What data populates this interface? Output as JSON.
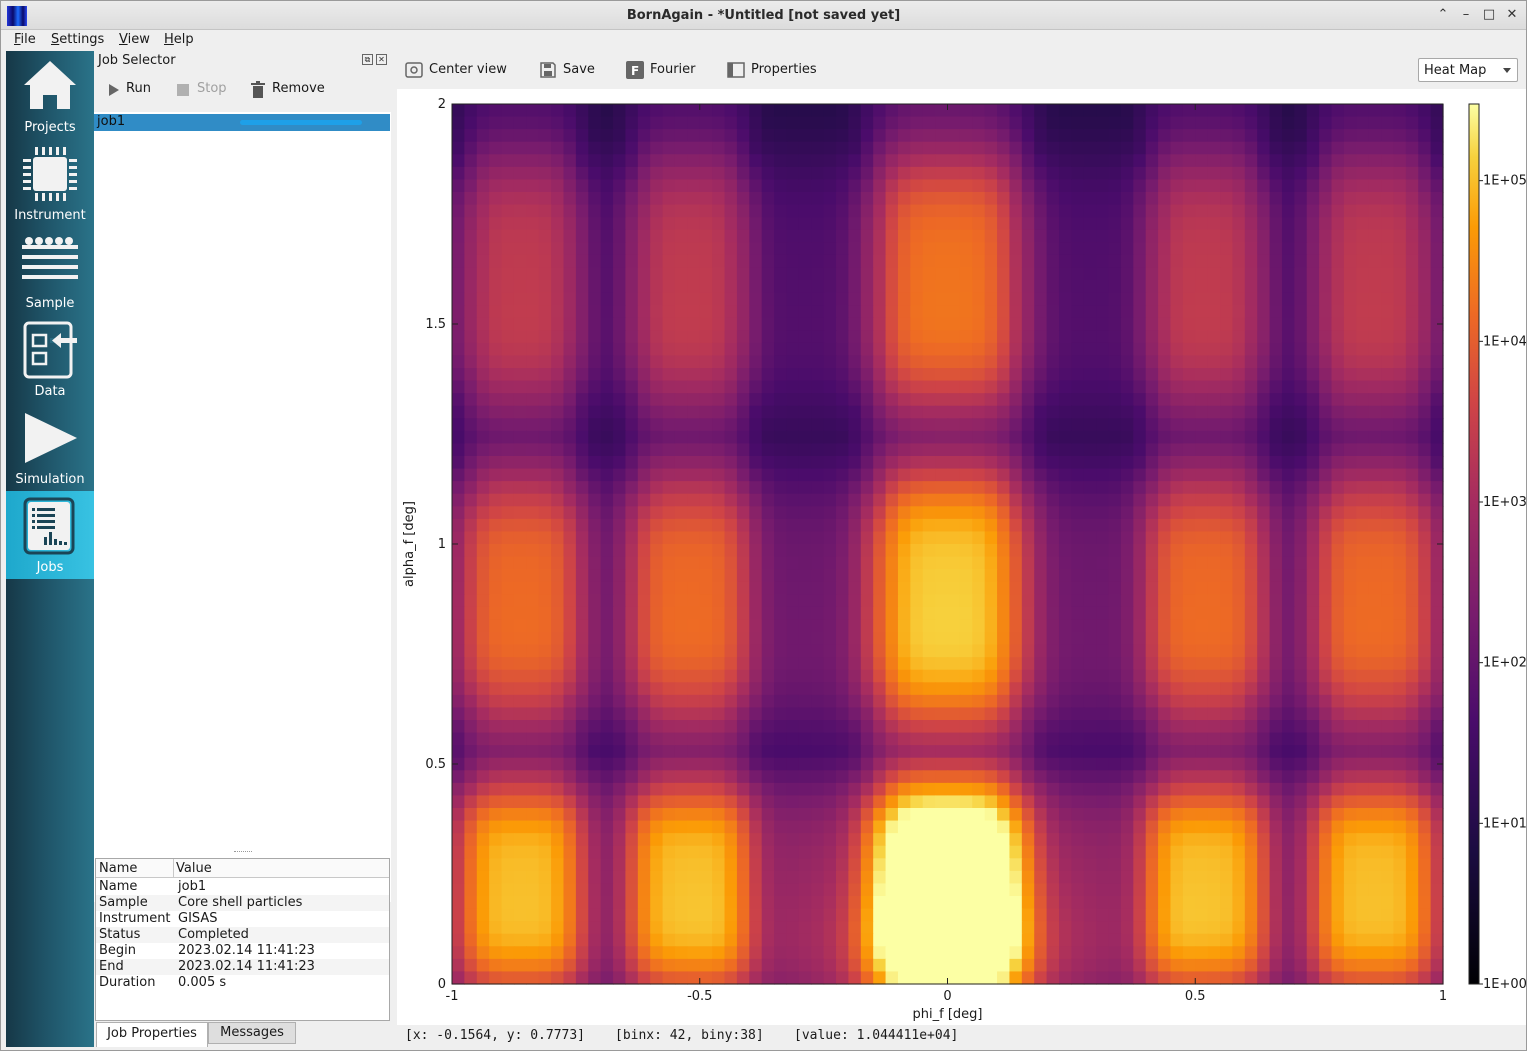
{
  "window": {
    "title": "BornAgain - *Untitled [not saved yet]"
  },
  "menu": [
    "File",
    "Settings",
    "View",
    "Help"
  ],
  "sidebar": {
    "items": [
      {
        "label": "Projects",
        "icon": "house-icon"
      },
      {
        "label": "Instrument",
        "icon": "chip-icon"
      },
      {
        "label": "Sample",
        "icon": "layers-icon"
      },
      {
        "label": "Data",
        "icon": "import-data-icon"
      },
      {
        "label": "Simulation",
        "icon": "play-icon"
      },
      {
        "label": "Jobs",
        "icon": "jobs-chart-icon",
        "active": true
      }
    ],
    "active_color": "#2ab4d6"
  },
  "job_selector": {
    "title": "Job Selector",
    "toolbar": {
      "run": "Run",
      "stop": "Stop",
      "remove": "Remove"
    },
    "jobs": [
      {
        "name": "job1",
        "selected": true,
        "progress": 1.0
      }
    ],
    "properties": {
      "header": {
        "name": "Name",
        "value": "Value"
      },
      "rows": [
        {
          "key": "Name",
          "value": "job1"
        },
        {
          "key": "Sample",
          "value": "Core shell particles"
        },
        {
          "key": "Instrument",
          "value": "GISAS"
        },
        {
          "key": "Status",
          "value": "Completed"
        },
        {
          "key": "Begin",
          "value": "2023.02.14 11:41:23"
        },
        {
          "key": "End",
          "value": "2023.02.14 11:41:23"
        },
        {
          "key": "Duration",
          "value": "0.005 s"
        }
      ]
    },
    "tabs": [
      "Job Properties",
      "Messages"
    ],
    "active_tab": "Job Properties"
  },
  "plot_toolbar": {
    "center_view": "Center view",
    "save": "Save",
    "fourier": "Fourier",
    "properties": "Properties",
    "view_mode": "Heat Map"
  },
  "chart_data": {
    "type": "heatmap",
    "colormap": "inferno",
    "xlabel": "phi_f [deg]",
    "ylabel": "alpha_f [deg]",
    "xlim": [
      -1,
      1
    ],
    "ylim": [
      0,
      2
    ],
    "x_ticks": [
      "-1",
      "-0.5",
      "0",
      "0.5",
      "1"
    ],
    "y_ticks": [
      "0",
      "0.5",
      "1",
      "1.5",
      "2"
    ],
    "colorbar": {
      "scale": "log",
      "range": [
        1,
        300000
      ],
      "ticks": [
        "1E+00",
        "1E+01",
        "1E+02",
        "1E+03",
        "1E+04",
        "1E+05"
      ]
    },
    "x_stripe_centers": [
      -0.86,
      -0.52,
      0,
      0.52,
      0.86
    ],
    "y_band_centers": [
      0.22,
      0.88,
      1.6
    ],
    "peak": {
      "x": 0,
      "y": 0,
      "value": 300000
    }
  },
  "status": {
    "coords": "[x: -0.1564, y: 0.7773]",
    "bins": "[binx: 42, biny:38]",
    "value": "[value: 1.044411e+04]"
  }
}
